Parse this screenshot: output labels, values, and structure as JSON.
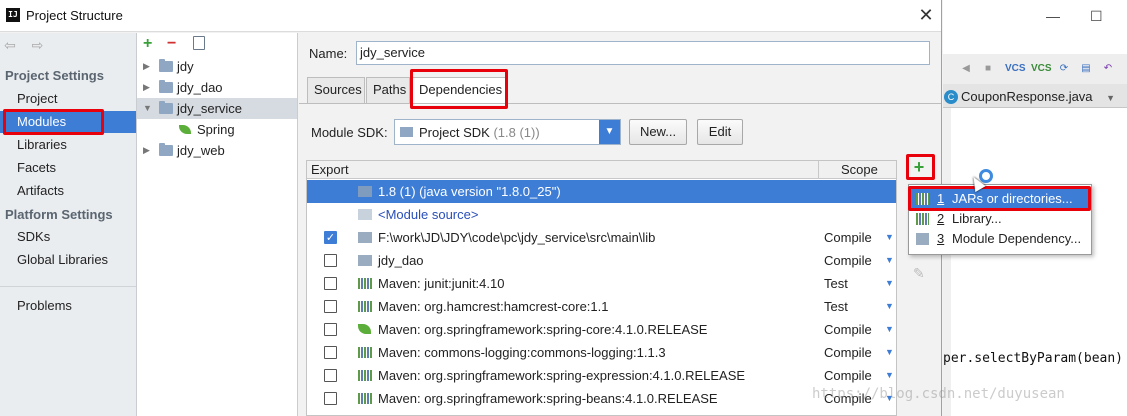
{
  "window": {
    "title": "Project Structure",
    "close_glyph": "✕"
  },
  "nav": {
    "back_forward": "⇦ ⇨",
    "project_settings_header": "Project Settings",
    "project_settings": [
      "Project",
      "Modules",
      "Libraries",
      "Facets",
      "Artifacts"
    ],
    "platform_settings_header": "Platform Settings",
    "platform_settings": [
      "SDKs",
      "Global Libraries"
    ],
    "other": [
      "Problems"
    ],
    "selected": "Modules"
  },
  "tree": {
    "add_glyph": "+",
    "remove_glyph": "−",
    "items": [
      "jdy",
      "jdy_dao",
      "jdy_service",
      "jdy_web"
    ],
    "child_of_selected": "Spring",
    "selected": "jdy_service"
  },
  "content": {
    "name_label": "Name:",
    "name_value": "jdy_service",
    "tabs": [
      "Sources",
      "Paths",
      "Dependencies"
    ],
    "active_tab": "Dependencies",
    "sdk_label": "Module SDK:",
    "sdk_value": "Project SDK",
    "sdk_version": "(1.8 (1))",
    "new_button": "New...",
    "edit_button": "Edit"
  },
  "dependencies": {
    "header_export": "Export",
    "header_scope": "Scope",
    "rows": [
      {
        "name": "1.8 (1) (java version \"1.8.0_25\")",
        "scope": "",
        "checkbox": "none",
        "icon": "folder-blue",
        "selected": true
      },
      {
        "name": "<Module source>",
        "scope": "",
        "checkbox": "none",
        "icon": "src",
        "link": true
      },
      {
        "name": "F:\\work\\JD\\JDY\\code\\pc\\jdy_service\\src\\main\\lib",
        "scope": "Compile",
        "checkbox": "checked",
        "icon": "folder"
      },
      {
        "name": "jdy_dao",
        "scope": "Compile",
        "checkbox": "unchecked",
        "icon": "folder"
      },
      {
        "name": "Maven: junit:junit:4.10",
        "scope": "Test",
        "checkbox": "unchecked",
        "icon": "lib"
      },
      {
        "name": "Maven: org.hamcrest:hamcrest-core:1.1",
        "scope": "Test",
        "checkbox": "unchecked",
        "icon": "lib"
      },
      {
        "name": "Maven: org.springframework:spring-core:4.1.0.RELEASE",
        "scope": "Compile",
        "checkbox": "unchecked",
        "icon": "spring"
      },
      {
        "name": "Maven: commons-logging:commons-logging:1.1.3",
        "scope": "Compile",
        "checkbox": "unchecked",
        "icon": "lib"
      },
      {
        "name": "Maven: org.springframework:spring-expression:4.1.0.RELEASE",
        "scope": "Compile",
        "checkbox": "unchecked",
        "icon": "lib"
      },
      {
        "name": "Maven: org.springframework:spring-beans:4.1.0.RELEASE",
        "scope": "Compile",
        "checkbox": "unchecked",
        "icon": "lib"
      }
    ],
    "add_glyph": "+",
    "edit_glyph": "✎"
  },
  "popup": {
    "items": [
      {
        "num": "1",
        "label": "JARs or directories...",
        "selected": true
      },
      {
        "num": "2",
        "label": "Library..."
      },
      {
        "num": "3",
        "label": "Module Dependency..."
      }
    ]
  },
  "ide": {
    "minimize_glyph": "—",
    "maximize_glyph": "☐",
    "file_tab": "CouponResponse.java",
    "code_line": "per.selectByParam(bean)",
    "vcs_label": "VCS",
    "watermark": "https://blog.csdn.net/duyusean"
  },
  "colors": {
    "selection": "#3d7dd6",
    "highlight": "#e8000b",
    "add_green": "#3aa03a"
  }
}
